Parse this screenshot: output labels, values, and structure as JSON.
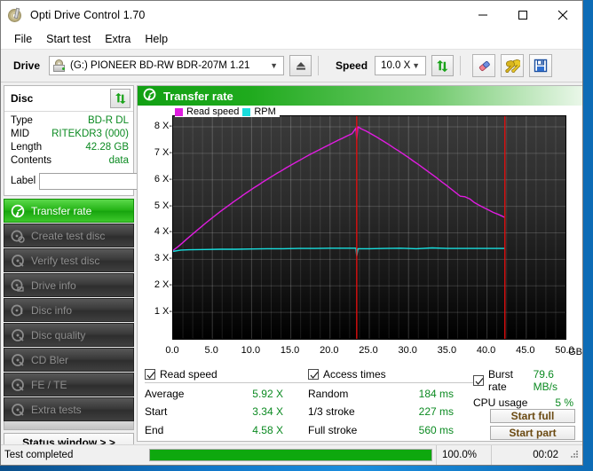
{
  "window": {
    "title": "Opti Drive Control 1.70",
    "icon": "disc-pen-icon",
    "minimize": "minimize-icon",
    "maximize": "maximize-icon",
    "close": "close-icon"
  },
  "menu": {
    "items": [
      "File",
      "Start test",
      "Extra",
      "Help"
    ]
  },
  "toolbar": {
    "drive_label": "Drive",
    "drive_value": "(G:)   PIONEER BD-RW   BDR-207M 1.21",
    "eject_icon": "eject-icon",
    "speed_label": "Speed",
    "speed_value": "10.0 X",
    "refresh_icon": "refresh-icon",
    "erase_icon": "erase-icon",
    "settings_icon": "wrench-icon",
    "save_icon": "save-icon"
  },
  "disc": {
    "title": "Disc",
    "refresh_icon": "refresh-icon",
    "rows": [
      {
        "key": "Type",
        "value": "BD-R DL"
      },
      {
        "key": "MID",
        "value": "RITEKDR3 (000)"
      },
      {
        "key": "Length",
        "value": "42.28 GB"
      },
      {
        "key": "Contents",
        "value": "data"
      }
    ],
    "label_key": "Label",
    "label_value": "",
    "label_placeholder": "",
    "label_button_icon": "disc-icon"
  },
  "sidebar": {
    "items": [
      {
        "label": "Transfer rate",
        "icon": "transfer-rate-icon",
        "active": true
      },
      {
        "label": "Create test disc",
        "icon": "create-disc-icon",
        "active": false
      },
      {
        "label": "Verify test disc",
        "icon": "verify-disc-icon",
        "active": false
      },
      {
        "label": "Drive info",
        "icon": "drive-info-icon",
        "active": false
      },
      {
        "label": "Disc info",
        "icon": "disc-info-icon",
        "active": false
      },
      {
        "label": "Disc quality",
        "icon": "disc-quality-icon",
        "active": false
      },
      {
        "label": "CD Bler",
        "icon": "cd-bler-icon",
        "active": false
      },
      {
        "label": "FE / TE",
        "icon": "fe-te-icon",
        "active": false
      },
      {
        "label": "Extra tests",
        "icon": "extra-tests-icon",
        "active": false
      }
    ],
    "status_window": "Status window > >"
  },
  "panel": {
    "title": "Transfer rate",
    "icon": "transfer-rate-icon"
  },
  "chart_data": {
    "type": "line",
    "title": "Transfer rate",
    "xlabel": "GB",
    "ylabel": "X",
    "xlim": [
      0.0,
      50.0
    ],
    "ylim": [
      0.0,
      8.4
    ],
    "grid": true,
    "legend_position": "top-left",
    "x_unit": "GB",
    "xticks": [
      "0.0",
      "5.0",
      "10.0",
      "15.0",
      "20.0",
      "25.0",
      "30.0",
      "35.0",
      "40.0",
      "45.0",
      "50.0"
    ],
    "xtick_values": [
      0,
      5,
      10,
      15,
      20,
      25,
      30,
      35,
      40,
      45,
      50
    ],
    "yticks": [
      "1 X",
      "2 X",
      "3 X",
      "4 X",
      "5 X",
      "6 X",
      "7 X",
      "8 X"
    ],
    "ytick_values": [
      1,
      2,
      3,
      4,
      5,
      6,
      7,
      8
    ],
    "markers": [
      {
        "label": "layer-break",
        "x": 23.4,
        "color": "#e01010"
      },
      {
        "label": "disc-end",
        "x": 42.28,
        "color": "#e01010"
      }
    ],
    "series": [
      {
        "name": "Read speed",
        "color": "#e01ce0",
        "points": [
          [
            0.0,
            3.34
          ],
          [
            0.6,
            3.47
          ],
          [
            1.2,
            3.62
          ],
          [
            1.8,
            3.78
          ],
          [
            2.4,
            3.93
          ],
          [
            3.0,
            4.08
          ],
          [
            3.6,
            4.23
          ],
          [
            4.2,
            4.38
          ],
          [
            4.8,
            4.52
          ],
          [
            5.4,
            4.66
          ],
          [
            6.0,
            4.8
          ],
          [
            6.6,
            4.93
          ],
          [
            7.2,
            5.06
          ],
          [
            7.8,
            5.19
          ],
          [
            8.4,
            5.31
          ],
          [
            9.0,
            5.44
          ],
          [
            9.6,
            5.56
          ],
          [
            10.2,
            5.68
          ],
          [
            10.8,
            5.79
          ],
          [
            11.4,
            5.91
          ],
          [
            12.0,
            6.02
          ],
          [
            12.6,
            6.13
          ],
          [
            13.2,
            6.24
          ],
          [
            13.8,
            6.34
          ],
          [
            14.4,
            6.45
          ],
          [
            15.0,
            6.55
          ],
          [
            15.6,
            6.65
          ],
          [
            16.2,
            6.75
          ],
          [
            16.8,
            6.85
          ],
          [
            17.4,
            6.95
          ],
          [
            18.0,
            7.04
          ],
          [
            18.6,
            7.13
          ],
          [
            19.2,
            7.22
          ],
          [
            19.8,
            7.31
          ],
          [
            20.4,
            7.4
          ],
          [
            21.0,
            7.49
          ],
          [
            21.6,
            7.57
          ],
          [
            22.2,
            7.66
          ],
          [
            22.8,
            7.74
          ],
          [
            23.3,
            7.95
          ],
          [
            23.4,
            7.52
          ],
          [
            23.55,
            8.0
          ],
          [
            24.0,
            7.92
          ],
          [
            24.6,
            7.84
          ],
          [
            25.2,
            7.74
          ],
          [
            25.8,
            7.64
          ],
          [
            26.4,
            7.53
          ],
          [
            27.0,
            7.42
          ],
          [
            27.6,
            7.31
          ],
          [
            28.2,
            7.19
          ],
          [
            28.8,
            7.08
          ],
          [
            29.4,
            6.96
          ],
          [
            30.0,
            6.84
          ],
          [
            30.6,
            6.71
          ],
          [
            31.2,
            6.59
          ],
          [
            31.8,
            6.46
          ],
          [
            32.4,
            6.33
          ],
          [
            33.0,
            6.2
          ],
          [
            33.6,
            6.07
          ],
          [
            34.2,
            5.93
          ],
          [
            34.8,
            5.8
          ],
          [
            35.4,
            5.66
          ],
          [
            36.0,
            5.52
          ],
          [
            36.6,
            5.38
          ],
          [
            37.2,
            5.36
          ],
          [
            37.8,
            5.28
          ],
          [
            38.4,
            5.14
          ],
          [
            39.0,
            5.04
          ],
          [
            39.6,
            4.95
          ],
          [
            40.2,
            4.86
          ],
          [
            40.8,
            4.77
          ],
          [
            41.4,
            4.7
          ],
          [
            42.0,
            4.62
          ],
          [
            42.28,
            4.58
          ]
        ]
      },
      {
        "name": "RPM",
        "color": "#18dede",
        "points": [
          [
            0.0,
            3.3
          ],
          [
            1.0,
            3.35
          ],
          [
            2.0,
            3.36
          ],
          [
            4.0,
            3.37
          ],
          [
            6.0,
            3.38
          ],
          [
            8.0,
            3.38
          ],
          [
            10.0,
            3.39
          ],
          [
            12.0,
            3.4
          ],
          [
            14.0,
            3.4
          ],
          [
            16.0,
            3.41
          ],
          [
            18.0,
            3.41
          ],
          [
            20.0,
            3.42
          ],
          [
            22.0,
            3.42
          ],
          [
            23.3,
            3.42
          ],
          [
            23.4,
            3.12
          ],
          [
            23.55,
            3.4
          ],
          [
            25.0,
            3.4
          ],
          [
            27.0,
            3.41
          ],
          [
            29.0,
            3.42
          ],
          [
            31.0,
            3.4
          ],
          [
            33.0,
            3.43
          ],
          [
            35.0,
            3.41
          ],
          [
            37.0,
            3.41
          ],
          [
            39.0,
            3.41
          ],
          [
            41.0,
            3.41
          ],
          [
            42.28,
            3.41
          ]
        ]
      }
    ],
    "legend": [
      {
        "label": "Read speed",
        "color": "#e01ce0"
      },
      {
        "label": "RPM",
        "color": "#18dede"
      }
    ]
  },
  "stats": {
    "read_speed": {
      "title": "Read speed",
      "checked": true,
      "rows": [
        {
          "key": "Average",
          "value": "5.92 X"
        },
        {
          "key": "Start",
          "value": "3.34 X"
        },
        {
          "key": "End",
          "value": "4.58 X"
        }
      ]
    },
    "access_times": {
      "title": "Access times",
      "checked": true,
      "rows": [
        {
          "key": "Random",
          "value": "184 ms"
        },
        {
          "key": "1/3 stroke",
          "value": "227 ms"
        },
        {
          "key": "Full stroke",
          "value": "560 ms"
        }
      ]
    },
    "burst": {
      "title": "Burst rate",
      "checked": true,
      "value": "79.6 MB/s",
      "cpu_key": "CPU usage",
      "cpu_value": "5 %",
      "start_full": "Start full",
      "start_part": "Start part"
    }
  },
  "statusbar": {
    "text": "Test completed",
    "percent_label": "100.0%",
    "percent_value": 100,
    "time": "00:02"
  },
  "colors": {
    "accent_green": "#1faa1d",
    "value_green": "#0b8a21",
    "read_speed": "#e01ce0",
    "rpm": "#18dede",
    "marker": "#e01010"
  }
}
